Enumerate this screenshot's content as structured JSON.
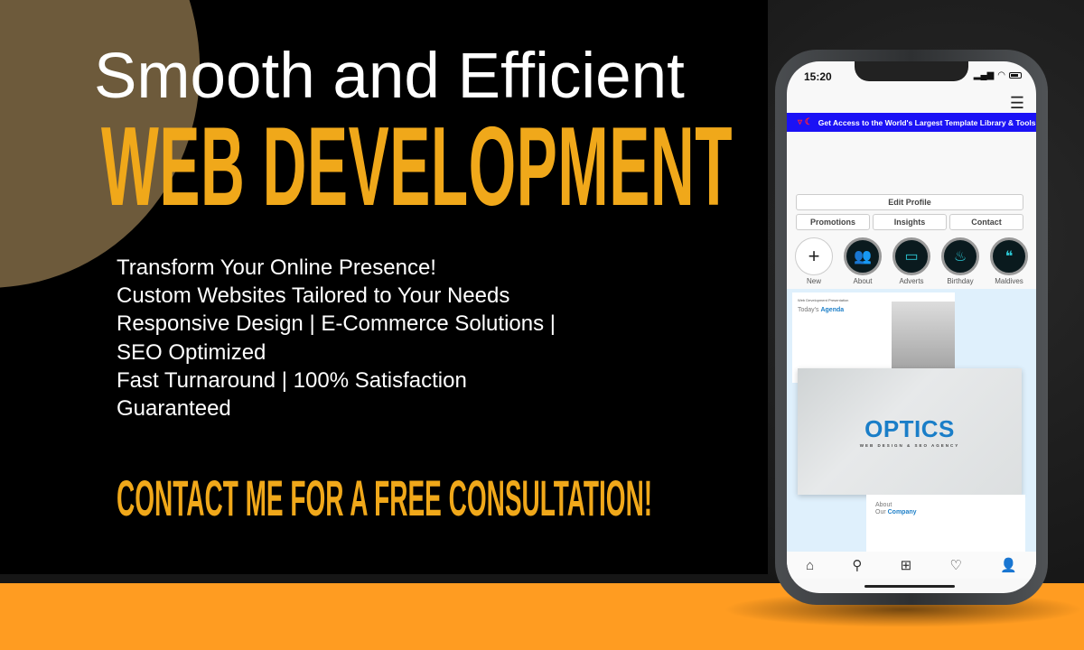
{
  "headline": {
    "line1": "Smooth and Efficient",
    "line2": "WEB DEVELOPMENT"
  },
  "features": [
    "Transform Your Online Presence!",
    "Custom Websites Tailored to Your Needs",
    "Responsive Design | E-Commerce Solutions |",
    "SEO Optimized",
    "Fast Turnaround | 100% Satisfaction",
    "Guaranteed"
  ],
  "cta": "CONTACT ME FOR A FREE CONSULTATION!",
  "colors": {
    "accent": "#f0a81a",
    "orange_band": "#ff9c21",
    "banner_blue": "#1b12f5",
    "brand_blue": "#1a7ec8"
  },
  "phone": {
    "time": "15:20",
    "banner": "Get Access to the World's Largest Template Library & Tools",
    "buttons": {
      "edit_profile": "Edit Profile",
      "promotions": "Promotions",
      "insights": "Insights",
      "contact": "Contact"
    },
    "highlights": [
      {
        "label": "New",
        "icon": "plus-icon"
      },
      {
        "label": "About",
        "icon": "users-icon"
      },
      {
        "label": "Adverts",
        "icon": "monitor-icon"
      },
      {
        "label": "Birthday",
        "icon": "cake-icon"
      },
      {
        "label": "Maldives",
        "icon": "quote-icon"
      }
    ],
    "post": {
      "slide1_small": "Web Development Presentation",
      "slide1_title_a": "Today's",
      "slide1_title_b": "Agenda",
      "brand": "OPTICS",
      "brand_sub": "WEB DESIGN & SEO AGENCY",
      "about_a": "About",
      "about_b": "Our",
      "about_c": "Company"
    },
    "tabbar": [
      "home-icon",
      "search-icon",
      "add-post-icon",
      "heart-icon",
      "profile-icon"
    ]
  }
}
